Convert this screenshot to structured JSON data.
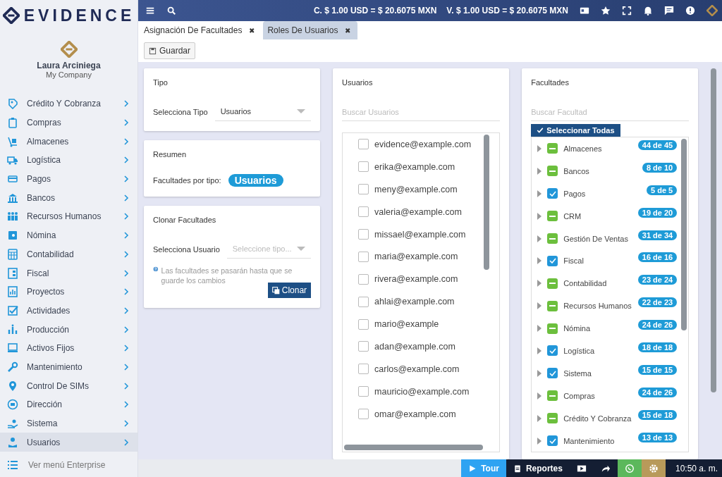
{
  "brand": {
    "name": "EVIDENCE"
  },
  "user": {
    "name": "Laura Arciniega",
    "company": "My Company"
  },
  "sidebar": {
    "items": [
      {
        "label": "Crédito Y Cobranza",
        "selected": false
      },
      {
        "label": "Compras",
        "selected": false
      },
      {
        "label": "Almacenes",
        "selected": false
      },
      {
        "label": "Logística",
        "selected": false
      },
      {
        "label": "Pagos",
        "selected": false
      },
      {
        "label": "Bancos",
        "selected": false
      },
      {
        "label": "Recursos Humanos",
        "selected": false
      },
      {
        "label": "Nómina",
        "selected": false
      },
      {
        "label": "Contabilidad",
        "selected": false
      },
      {
        "label": "Fiscal",
        "selected": false
      },
      {
        "label": "Proyectos",
        "selected": false
      },
      {
        "label": "Actividades",
        "selected": false
      },
      {
        "label": "Producción",
        "selected": false
      },
      {
        "label": "Activos Fijos",
        "selected": false
      },
      {
        "label": "Mantenimiento",
        "selected": false
      },
      {
        "label": "Control De SIMs",
        "selected": false
      },
      {
        "label": "Dirección",
        "selected": false
      },
      {
        "label": "Sistema",
        "selected": false
      },
      {
        "label": "Usuarios",
        "selected": true
      }
    ],
    "footer": "Ver menú Enterprise"
  },
  "topbar": {
    "rates": [
      "C. $ 1.00 USD = $ 20.6075 MXN",
      "V. $ 1.00 USD = $ 20.6075 MXN"
    ]
  },
  "tabs": [
    {
      "label": "Asignación De Facultades",
      "selected": true,
      "close": "✖"
    },
    {
      "label": "Roles De Usuarios",
      "selected": false,
      "close": "✖"
    }
  ],
  "toolbar": {
    "save": "Guardar"
  },
  "tipo": {
    "title": "Tipo",
    "label": "Selecciona Tipo",
    "value": "Usuarios"
  },
  "resumen": {
    "title": "Resumen",
    "label": "Facultades por tipo:",
    "badge": "Usuarios"
  },
  "clonar": {
    "title": "Clonar Facultades",
    "label": "Selecciona Usuario",
    "placeholder": "Seleccione tipo...",
    "hint": "Las facultades se pasarán hasta que se guarde los cambios",
    "button": "Clonar"
  },
  "usuarios": {
    "title": "Usuarios",
    "search_placeholder": "Buscar Usuarios",
    "items": [
      {
        "email": "evidence@example.com",
        "checked": false
      },
      {
        "email": "erika@example.com",
        "checked": false
      },
      {
        "email": "meny@example.com",
        "checked": false
      },
      {
        "email": "valeria@example.com",
        "checked": false
      },
      {
        "email": "missael@example.com",
        "checked": false
      },
      {
        "email": "maria@example.com",
        "checked": false
      },
      {
        "email": "rivera@example.com",
        "checked": false
      },
      {
        "email": "ahlai@example.com",
        "checked": false
      },
      {
        "email": "mario@example",
        "checked": false
      },
      {
        "email": "adan@example.com",
        "checked": false
      },
      {
        "email": "carlos@example.com",
        "checked": false
      },
      {
        "email": "mauricio@example.com",
        "checked": false
      },
      {
        "email": "omar@example.com",
        "checked": false
      }
    ]
  },
  "facultades": {
    "title": "Facultades",
    "search_placeholder": "Buscar Facultad",
    "select_all": "Seleccionar Todas",
    "items": [
      {
        "kind": "partial",
        "checked": true,
        "label": "Almacenes",
        "count": "44 de 45"
      },
      {
        "kind": "partial",
        "checked": true,
        "label": "Bancos",
        "count": "8 de 10"
      },
      {
        "kind": "full",
        "checked": true,
        "label": "Pagos",
        "count": "5 de 5"
      },
      {
        "kind": "partial",
        "checked": true,
        "label": "CRM",
        "count": "19 de 20"
      },
      {
        "kind": "partial",
        "checked": true,
        "label": "Gestión De Ventas",
        "count": "31 de 34"
      },
      {
        "kind": "full",
        "checked": true,
        "label": "Fiscal",
        "count": "16 de 16"
      },
      {
        "kind": "partial",
        "checked": true,
        "label": "Contabilidad",
        "count": "23 de 24"
      },
      {
        "kind": "partial",
        "checked": true,
        "label": "Recursos Humanos",
        "count": "22 de 23"
      },
      {
        "kind": "partial",
        "checked": true,
        "label": "Nómina",
        "count": "24 de 26"
      },
      {
        "kind": "full",
        "checked": true,
        "label": "Logística",
        "count": "18 de 18"
      },
      {
        "kind": "full",
        "checked": true,
        "label": "Sistema",
        "count": "15 de 15"
      },
      {
        "kind": "partial",
        "checked": true,
        "label": "Compras",
        "count": "24 de 26"
      },
      {
        "kind": "partial",
        "checked": true,
        "label": "Crédito Y Cobranza",
        "count": "15 de 18"
      },
      {
        "kind": "full",
        "checked": true,
        "label": "Mantenimiento",
        "count": "13 de 13"
      }
    ]
  },
  "statusbar": {
    "tour": "Tour",
    "reports": "Reportes",
    "time": "10:50 a. m."
  }
}
